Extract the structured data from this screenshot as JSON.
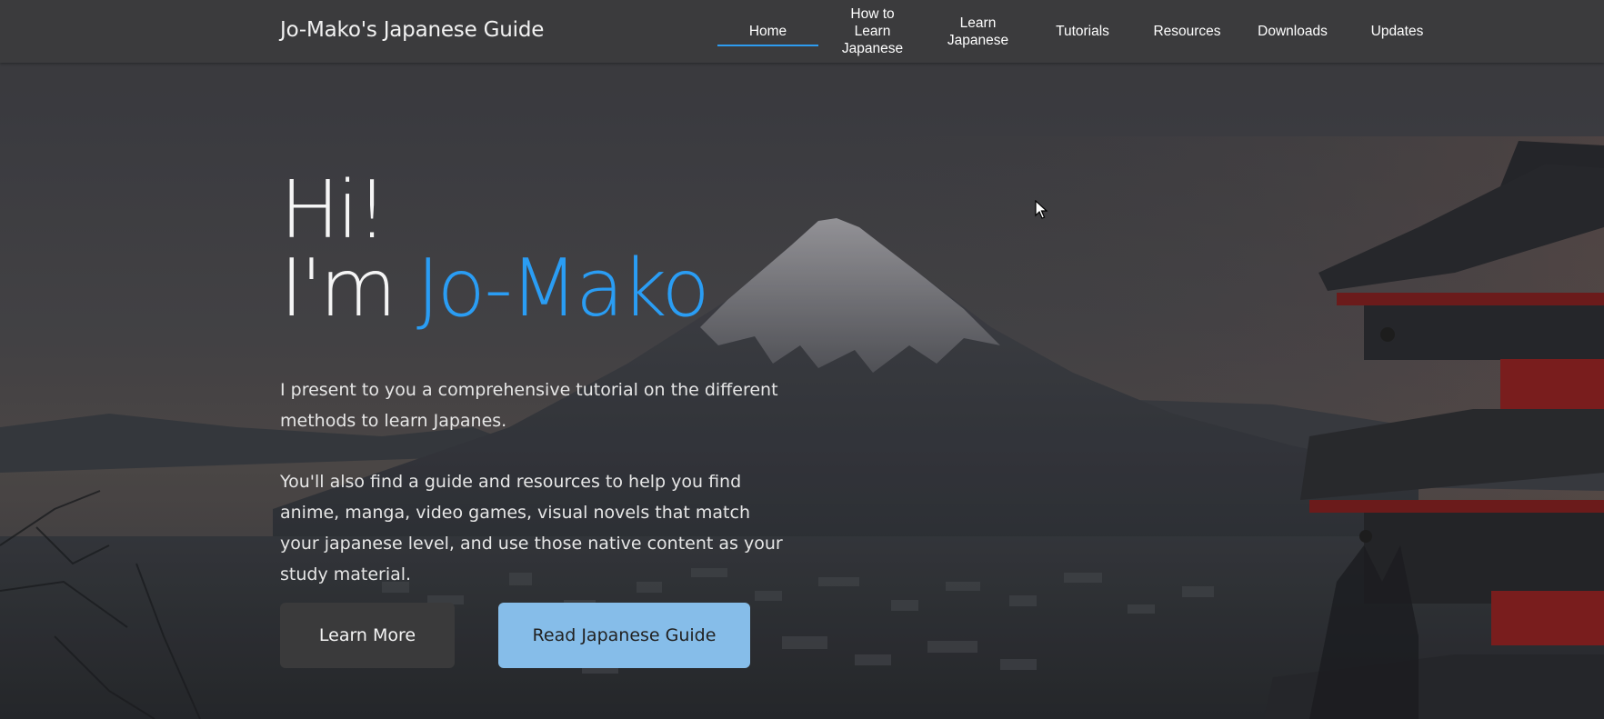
{
  "nav": {
    "brand": "Jo-Mako's Japanese Guide",
    "items": [
      {
        "label": "Home",
        "active": true
      },
      {
        "label": "How to Learn Japanese",
        "active": false
      },
      {
        "label": "Learn Japanese",
        "active": false
      },
      {
        "label": "Tutorials",
        "active": false
      },
      {
        "label": "Resources",
        "active": false
      },
      {
        "label": "Downloads",
        "active": false
      },
      {
        "label": "Updates",
        "active": false
      }
    ]
  },
  "hero": {
    "line1": "Hi!",
    "line2_prefix": "I'm ",
    "line2_name": "Jo-Mako",
    "paragraph1": "I present to you a comprehensive tutorial on the different methods to learn Japanes.",
    "paragraph2": "You'll also find a guide and resources to help you find anime, manga, video games, visual novels that match your japanese level, and use those native content as your study material."
  },
  "buttons": {
    "learn_more": "Learn More",
    "read_guide": "Read Japanese Guide"
  },
  "colors": {
    "accent": "#2a9df4",
    "nav_bg": "#3b3b3d",
    "button_dark": "#3a3a3b",
    "button_light": "#86bde9"
  }
}
